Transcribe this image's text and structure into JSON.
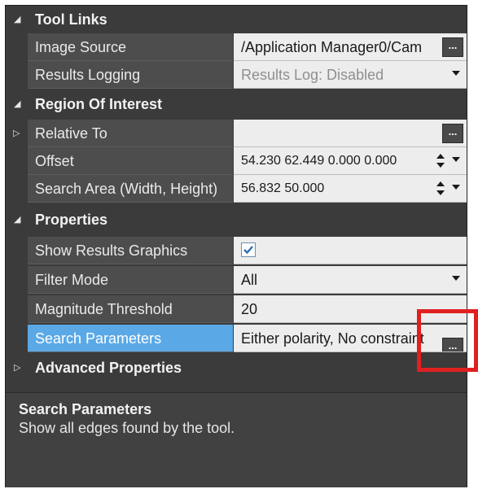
{
  "categories": {
    "tool_links": "Tool Links",
    "region_of_interest": "Region Of Interest",
    "properties": "Properties",
    "advanced_properties": "Advanced Properties"
  },
  "props": {
    "image_source": {
      "name": "Image Source",
      "value": "/Application Manager0/Cam"
    },
    "results_logging": {
      "name": "Results Logging",
      "value": "Results Log: Disabled"
    },
    "relative_to": {
      "name": "Relative To",
      "value": ""
    },
    "offset": {
      "name": "Offset",
      "value": "54.230 62.449 0.000 0.000"
    },
    "search_area": {
      "name": "Search Area (Width, Height)",
      "value": "56.832 50.000"
    },
    "show_results_graphics": {
      "name": "Show Results Graphics",
      "checked": true
    },
    "filter_mode": {
      "name": "Filter Mode",
      "value": "All"
    },
    "magnitude_threshold": {
      "name": "Magnitude Threshold",
      "value": "20"
    },
    "search_parameters": {
      "name": "Search Parameters",
      "value": "Either polarity, No constraint"
    }
  },
  "ellipsis_label": "...",
  "description": {
    "title": "Search Parameters",
    "text": "Show all edges found by the tool."
  },
  "colors": {
    "panel_bg": "#3b3b3b",
    "selected": "#5aa9e6",
    "highlight": "#e02020"
  }
}
